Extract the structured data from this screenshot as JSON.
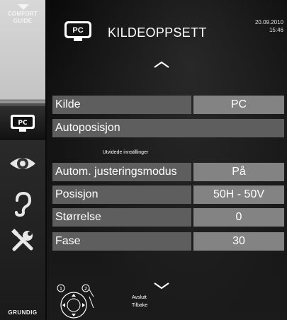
{
  "sidebar": {
    "comfort_guide": "COMFORT\nGUIDE",
    "brand": "GRUNDIG",
    "icons": [
      "source-pc-icon",
      "eye-icon",
      "ear-icon",
      "tools-icon"
    ]
  },
  "header": {
    "badge": "PC",
    "title": "KILDEOPPSETT",
    "date": "20.09.2010",
    "time": "15:46"
  },
  "menu": {
    "source": {
      "label": "Kilde",
      "value": "PC"
    },
    "autoposition": {
      "label": "Autoposisjon"
    },
    "advanced_heading": "Utvidede innstillinger",
    "items": [
      {
        "label": "Autom. justeringsmodus",
        "value": "På"
      },
      {
        "label": "Posisjon",
        "value": "50H - 50V"
      },
      {
        "label": "Størrelse",
        "value": "0"
      },
      {
        "label": "Fase",
        "value": "30"
      }
    ]
  },
  "footer": {
    "exit_label": "Avslutt",
    "back_label": "Tilbake"
  }
}
